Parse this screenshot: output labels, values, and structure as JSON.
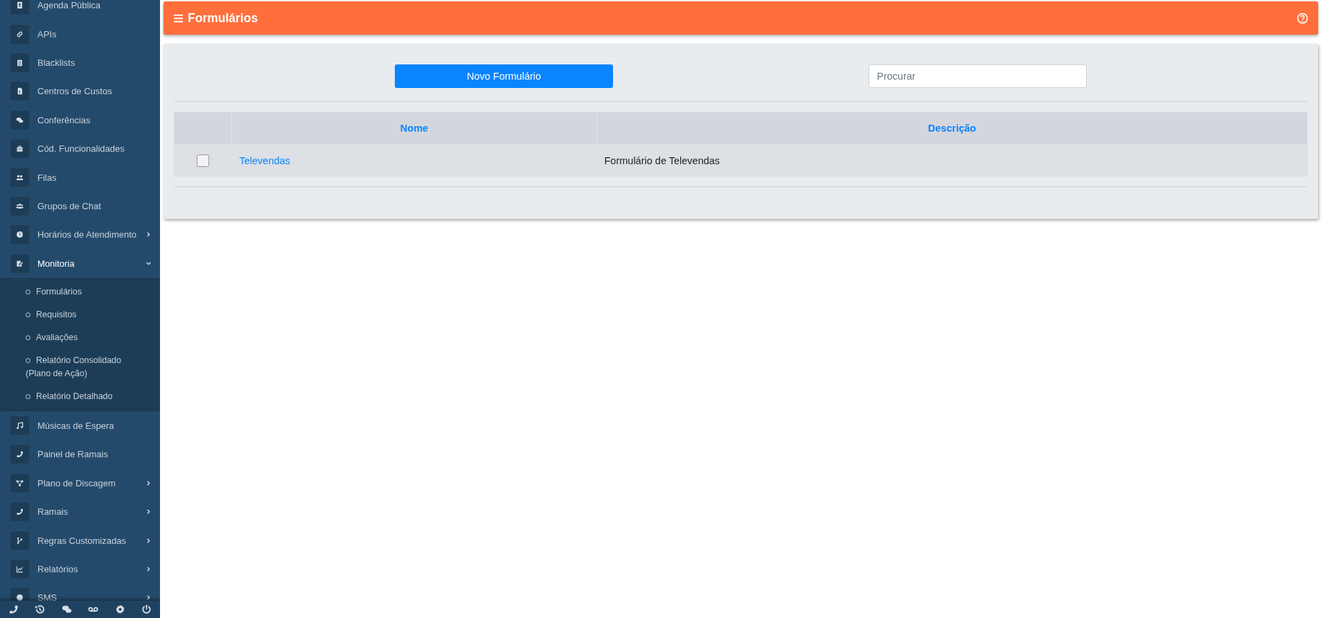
{
  "sidebar": {
    "items": [
      {
        "label": "Agenda Pública",
        "selected": false
      },
      {
        "label": "APIs",
        "selected": false
      },
      {
        "label": "Blacklists",
        "selected": false
      },
      {
        "label": "Centros de Custos",
        "selected": false
      },
      {
        "label": "Conferências",
        "selected": false
      },
      {
        "label": "Cód. Funcionalidades",
        "selected": false
      },
      {
        "label": "Filas",
        "selected": false
      },
      {
        "label": "Grupos de Chat",
        "selected": false
      },
      {
        "label": "Horários de Atendimento",
        "selected": false,
        "expanded": false
      },
      {
        "label": "Monitoria",
        "selected": true,
        "expanded": true,
        "children": [
          {
            "label": "Formulários"
          },
          {
            "label": "Requisitos"
          },
          {
            "label": "Avaliações"
          },
          {
            "label": "Relatório Consolidado (Plano de Ação)"
          },
          {
            "label": "Relatório Detalhado"
          }
        ]
      },
      {
        "label": "Músicas de Espera",
        "selected": false
      },
      {
        "label": "Painel de Ramais",
        "selected": false
      },
      {
        "label": "Plano de Discagem",
        "selected": false,
        "expanded": false
      },
      {
        "label": "Ramais",
        "selected": false,
        "expanded": false
      },
      {
        "label": "Regras Customizadas",
        "selected": false,
        "expanded": false
      },
      {
        "label": "Relatórios",
        "selected": false,
        "expanded": false
      },
      {
        "label": "SMS",
        "selected": false,
        "expanded": false
      }
    ]
  },
  "header": {
    "title": "Formulários"
  },
  "toolbar": {
    "new_button": "Novo Formulário",
    "search": {
      "placeholder": "Procurar"
    }
  },
  "table": {
    "columns": [
      {
        "label": "Nome"
      },
      {
        "label": "Descrição"
      }
    ],
    "rows": [
      {
        "checked": false,
        "cells": [
          "Televendas",
          "Formulário de Televendas"
        ]
      }
    ]
  }
}
